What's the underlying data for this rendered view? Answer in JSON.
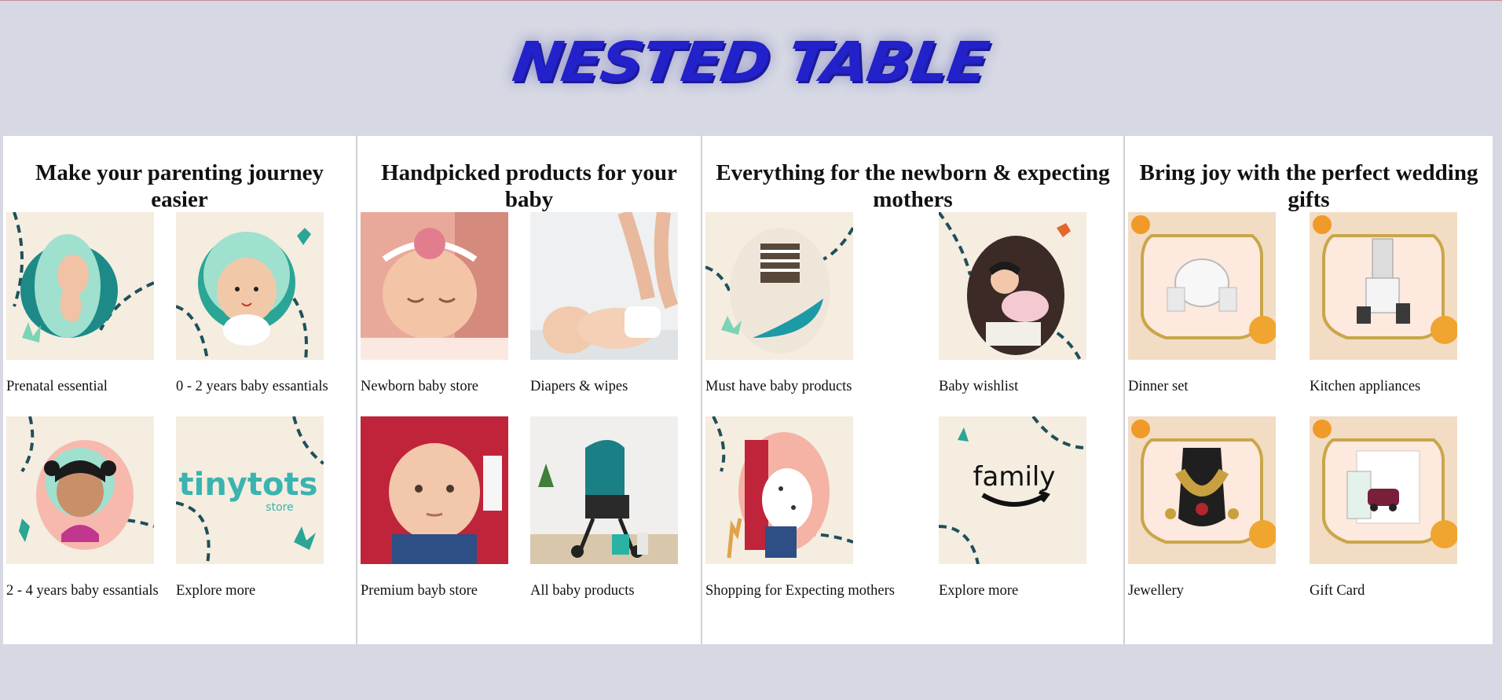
{
  "page": {
    "title": "NESTED TABLE"
  },
  "sections": [
    {
      "title": "Make your parenting journey easier",
      "items": [
        {
          "label": "Prenatal essential",
          "icon": "baby-fetus-illustration-icon"
        },
        {
          "label": "0 - 2 years baby essantials",
          "icon": "baby-face-illustration-icon"
        },
        {
          "label": "2 - 4 years baby essantials",
          "icon": "girl-face-illustration-icon"
        },
        {
          "label": "Explore more",
          "icon": "tinytots-store-logo-icon"
        }
      ]
    },
    {
      "title": "Handpicked products for your baby",
      "items": [
        {
          "label": "Newborn baby store",
          "icon": "sleeping-newborn-photo-icon"
        },
        {
          "label": "Diapers & wipes",
          "icon": "baby-diaper-photo-icon"
        },
        {
          "label": "Premium bayb store",
          "icon": "baby-in-car-seat-photo-icon"
        },
        {
          "label": "All baby products",
          "icon": "baby-stroller-photo-icon"
        }
      ]
    },
    {
      "title": "Everything for the newborn & expecting mothers",
      "items": [
        {
          "label": "Must have baby products",
          "icon": "crawling-baby-illustration-icon"
        },
        {
          "label": "Baby wishlist",
          "icon": "baby-with-toys-illustration-icon"
        },
        {
          "label": "Shopping for Expecting mothers",
          "icon": "expecting-mother-illustration-icon"
        },
        {
          "label": "Explore more",
          "icon": "amazon-family-logo-icon"
        }
      ]
    },
    {
      "title": "Bring joy with the perfect wedding gifts",
      "items": [
        {
          "label": "Dinner set",
          "icon": "dinner-set-photo-icon"
        },
        {
          "label": "Kitchen appliances",
          "icon": "mixer-grinder-photo-icon"
        },
        {
          "label": "Jewellery",
          "icon": "necklace-set-photo-icon"
        },
        {
          "label": "Gift Card",
          "icon": "gift-card-photo-icon"
        }
      ]
    }
  ],
  "logos": {
    "tinytots": "tinytots",
    "tinytots_sub": "store",
    "amazon_family": "family"
  },
  "colors": {
    "background": "#d6d8e3",
    "title": "#2321c9",
    "card": "#ffffff",
    "illustration_cream": "#f4ede0",
    "illustration_teal": "#2a9d9a",
    "wedding_frame": "#c9a64a"
  }
}
